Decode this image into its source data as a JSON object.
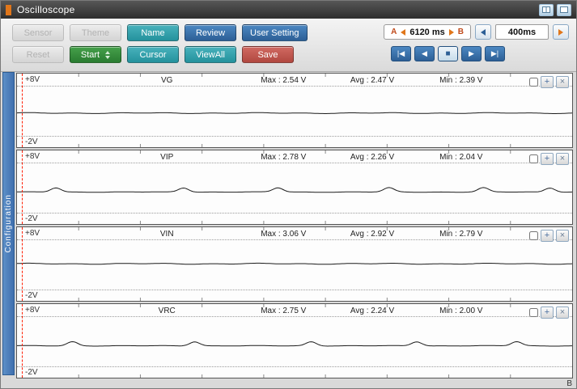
{
  "window": {
    "title": "Oscilloscope"
  },
  "toolbar": {
    "row1": [
      {
        "label": "Sensor",
        "variant": "disabled"
      },
      {
        "label": "Theme",
        "variant": "disabled"
      },
      {
        "label": "Name",
        "variant": "teal"
      },
      {
        "label": "Review",
        "variant": "blue"
      },
      {
        "label": "User Setting",
        "variant": "blue"
      }
    ],
    "row2": [
      {
        "label": "Reset",
        "variant": "disabled"
      },
      {
        "label": "Start",
        "variant": "green"
      },
      {
        "label": "Cursor",
        "variant": "teal"
      },
      {
        "label": "ViewAll",
        "variant": "teal"
      },
      {
        "label": "Save",
        "variant": "red"
      }
    ],
    "ab_range": {
      "a": "A",
      "value": "6120 ms",
      "b": "B"
    },
    "timebase": "400ms",
    "playback": [
      {
        "name": "first",
        "glyph": "|◀"
      },
      {
        "name": "rewind",
        "glyph": "◀"
      },
      {
        "name": "stop",
        "glyph": "■"
      },
      {
        "name": "play",
        "glyph": "▶"
      },
      {
        "name": "last",
        "glyph": "▶|"
      }
    ]
  },
  "sidebar": {
    "tab_label": "Configuration"
  },
  "channels": [
    {
      "name": "VG",
      "top_label": "+8V",
      "bottom_label": "-2V",
      "max": "Max : 2.54 V",
      "avg": "Avg : 2.47 V",
      "min": "Min : 2.39 V",
      "wave": {
        "base": 2.45,
        "peak": 2.54,
        "bumps": [],
        "bump_width": 0.013,
        "ripple": 0.08
      }
    },
    {
      "name": "VIP",
      "top_label": "+8V",
      "bottom_label": "-2V",
      "max": "Max : 2.78 V",
      "avg": "Avg : 2.26 V",
      "min": "Min : 2.04 V",
      "wave": {
        "base": 2.12,
        "peak": 2.78,
        "bumps": [
          0.07,
          0.3,
          0.47,
          0.67,
          0.84,
          0.96
        ],
        "bump_width": 0.013,
        "ripple": 0.05
      }
    },
    {
      "name": "VIN",
      "top_label": "+8V",
      "bottom_label": "-2V",
      "max": "Max : 3.06 V",
      "avg": "Avg : 2.92 V",
      "min": "Min : 2.79 V",
      "wave": {
        "base": 2.92,
        "peak": 3.02,
        "bumps": [],
        "bump_width": 0.013,
        "ripple": 0.09
      }
    },
    {
      "name": "VRC",
      "top_label": "+8V",
      "bottom_label": "-2V",
      "max": "Max : 2.75 V",
      "avg": "Avg : 2.24 V",
      "min": "Min : 2.00 V",
      "wave": {
        "base": 2.1,
        "peak": 2.75,
        "bumps": [
          0.1,
          0.32,
          0.53,
          0.72,
          0.9
        ],
        "bump_width": 0.013,
        "ripple": 0.05
      }
    }
  ],
  "panel_controls": {
    "expand_icon": "+",
    "close_icon": "×"
  },
  "footer": {
    "b_cursor_label": "B"
  },
  "colors": {
    "accent_orange": "#e0761a",
    "teal": "#24929d",
    "blue": "#2d5f96",
    "green": "#2a7c31",
    "red": "#b14840",
    "sidebar_blue": "#3f6fae",
    "cursor_red": "#ff1e00"
  }
}
